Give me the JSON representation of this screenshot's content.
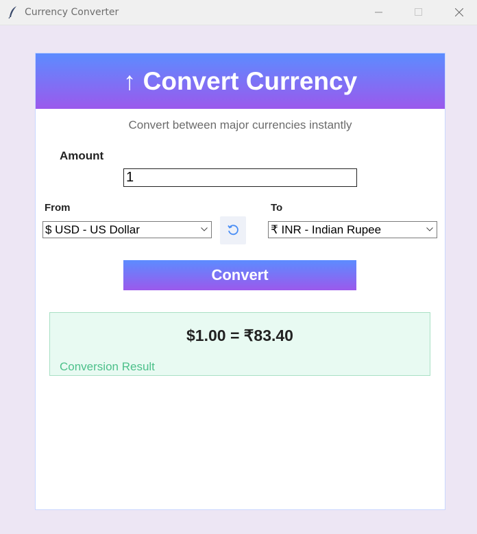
{
  "window": {
    "title": "Currency Converter",
    "icon": "feather-icon"
  },
  "header": {
    "title": "↑ Convert Currency"
  },
  "subtitle": "Convert between major currencies instantly",
  "amount": {
    "label": "Amount",
    "value": "1"
  },
  "from": {
    "label": "From",
    "selected": "$ USD - US Dollar"
  },
  "to": {
    "label": "To",
    "selected": "₹ INR - Indian Rupee"
  },
  "convert_button": "Convert",
  "result": {
    "value": "$1.00 = ₹83.40",
    "label": "Conversion Result"
  },
  "colors": {
    "background": "#ede6f4",
    "gradient_start": "#5c8cff",
    "gradient_end": "#9b59ec",
    "result_bg": "#e8faf2",
    "result_label": "#4cc08a"
  }
}
